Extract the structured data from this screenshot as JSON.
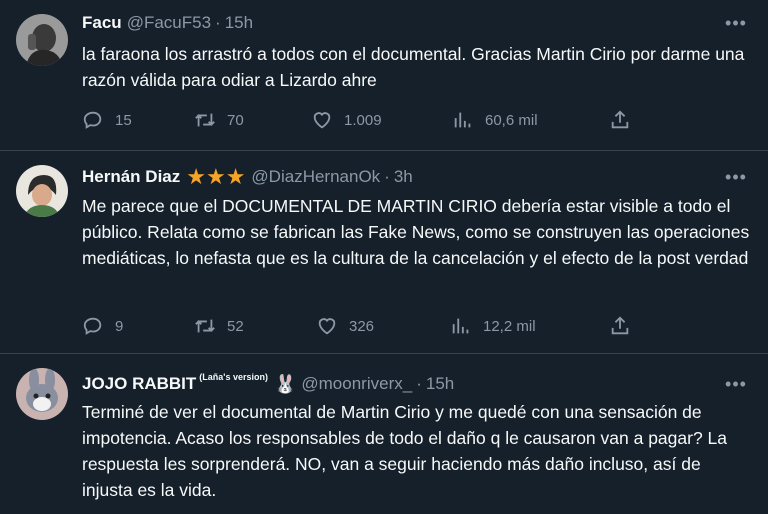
{
  "tweets": [
    {
      "name": "Facu",
      "handle": "@FacuF53",
      "time": "15h",
      "text": "la faraona los arrastró a todos con el documental. Gracias Martin Cirio por darme una razón válida para odiar a Lizardo ahre",
      "replies": "15",
      "retweets": "70",
      "likes": "1.009",
      "views": "60,6 mil"
    },
    {
      "name": "Hernán Diaz",
      "badge": "★★★",
      "handle": "@DiazHernanOk",
      "time": "3h",
      "text": "Me parece que el DOCUMENTAL DE MARTIN CIRIO debería estar visible a todo el público. Relata como se fabrican las Fake News, como se construyen las operaciones mediáticas, lo nefasta que es la cultura de la cancelación y el efecto de la post verdad",
      "replies": "9",
      "retweets": "52",
      "likes": "326",
      "views": "12,2 mil"
    },
    {
      "name": "JOJO RABBIT",
      "name_suffix": "(Laña's version)",
      "emoji": "🐰",
      "handle": "@moonriverx_",
      "time": "15h",
      "text": "Terminé de ver el documental de Martin Cirio y me quedé con una sensación de impotencia. Acaso los responsables de todo el daño q le causaron van a pagar? La respuesta les sorprenderá. NO, van a seguir haciendo más daño incluso, así de injusta es la vida."
    }
  ],
  "labels": {
    "dot": "·",
    "more": "•••"
  },
  "icons": [
    "reply-icon",
    "retweet-icon",
    "like-icon",
    "views-icon",
    "share-icon",
    "more-icon"
  ],
  "colors": {
    "background": "#15202b",
    "text": "#f7f9f9",
    "muted": "#8b98a5",
    "divider": "#38444d",
    "star": "#f4a427"
  }
}
